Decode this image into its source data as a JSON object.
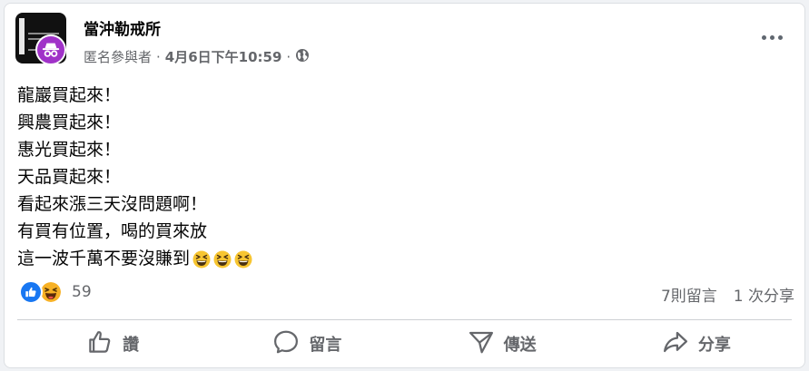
{
  "post": {
    "page_name": "當沖勒戒所",
    "author": "匿名參與者",
    "separator": "·",
    "timestamp": "4月6日下午10:59",
    "privacy_icon": "globe-icon",
    "more_icon": "more-options-icon",
    "lines": [
      "龍巖買起來！",
      "興農買起來！",
      "惠光買起來！",
      "天品買起來！",
      "看起來漲三天沒問題啊！",
      "有買有位置，喝的買來放",
      "這一波千萬不要沒賺到"
    ],
    "trailing_emoji": "grinning-squinting-face",
    "trailing_emoji_count": 3
  },
  "reactions": {
    "types": [
      "like",
      "haha"
    ],
    "count": "59"
  },
  "stats": {
    "comments": "7則留言",
    "shares": "1 次分享"
  },
  "actions": {
    "like": "讚",
    "comment": "留言",
    "send": "傳送",
    "share": "分享"
  },
  "colors": {
    "brand_blue": "#1877f2",
    "anon_purple": "#a032c8",
    "secondary_text": "#65676b",
    "haha_yellow": "#f7b125"
  }
}
